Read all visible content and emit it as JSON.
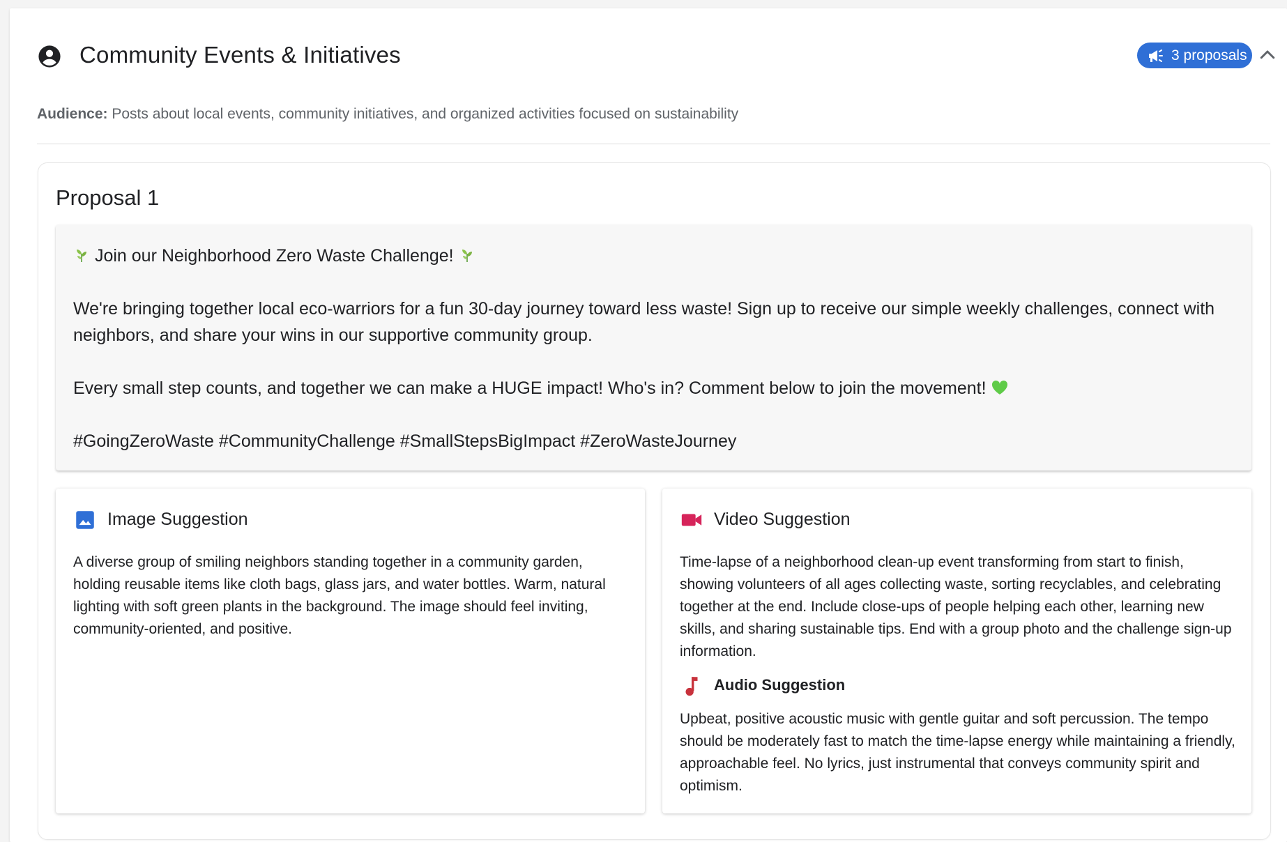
{
  "section": {
    "title": "Community Events & Initiatives",
    "badge_label": "3 proposals",
    "audience_label": "Audience:",
    "audience_text": "Posts about local events, community initiatives, and organized activities focused on sustainability"
  },
  "proposal": {
    "title": "Proposal 1",
    "post": {
      "headline": "Join our Neighborhood Zero Waste Challenge!",
      "paragraph1": "We're bringing together local eco-warriors for a fun 30-day journey toward less waste! Sign up to receive our simple weekly challenges, connect with neighbors, and share your wins in our supportive community group.",
      "paragraph2": "Every small step counts, and together we can make a HUGE impact! Who's in? Comment below to join the movement!",
      "hashtags": "#GoingZeroWaste #CommunityChallenge #SmallStepsBigImpact #ZeroWasteJourney"
    },
    "image_suggestion": {
      "label": "Image Suggestion",
      "text": "A diverse group of smiling neighbors standing together in a community garden, holding reusable items like cloth bags, glass jars, and water bottles. Warm, natural lighting with soft green plants in the background. The image should feel inviting, community-oriented, and positive."
    },
    "video_suggestion": {
      "label": "Video Suggestion",
      "text": "Time-lapse of a neighborhood clean-up event transforming from start to finish, showing volunteers of all ages collecting waste, sorting recyclables, and celebrating together at the end. Include close-ups of people helping each other, learning new skills, and sharing sustainable tips. End with a group photo and the challenge sign-up information."
    },
    "audio_suggestion": {
      "label": "Audio Suggestion",
      "text": "Upbeat, positive acoustic music with gentle guitar and soft percussion. The tempo should be moderately fast to match the time-lapse energy while maintaining a friendly, approachable feel. No lyrics, just instrumental that conveys community spirit and optimism."
    }
  },
  "icons": {
    "title": "account-circle-icon",
    "badge": "campaign-megaphone-icon",
    "collapse": "chevron-up-icon",
    "image": "image-icon",
    "video": "videocam-icon",
    "audio": "music-note-icon",
    "emoji_leaf": "herb-emoji",
    "emoji_heart": "green-heart-emoji"
  },
  "colors": {
    "badge_bg": "#2f6fd6",
    "image_icon": "#2f6fd6",
    "video_icon": "#d6245a",
    "audio_icon": "#c8323c",
    "post_bg": "#f7f7f7"
  }
}
